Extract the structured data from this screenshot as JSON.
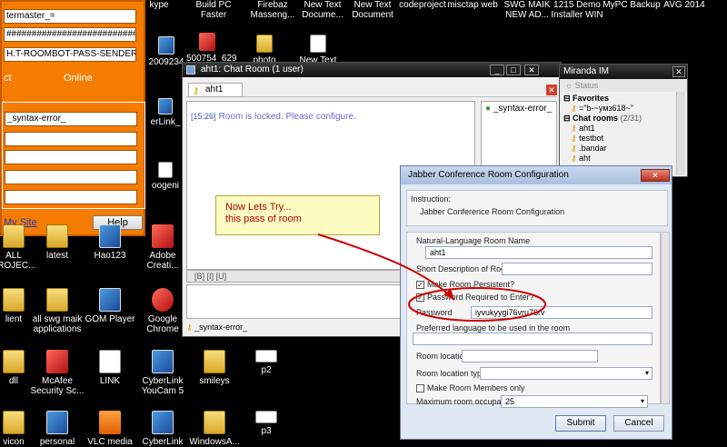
{
  "top_labels": [
    "kype",
    "Build PC Faster",
    "Firebaz Masseng...",
    "New Text Docume...",
    "New Text Document",
    "codeproject",
    "misctap web",
    "SWG MAIK NEW AD...",
    "1215 Demo Installer WIN",
    "MyPC Backup",
    "AVG 2014"
  ],
  "orange_panel": {
    "field1": "termaster_=",
    "field2": "############################",
    "field3": "H.T-ROOMBOT-PASS-SENDER",
    "status_left": "ct",
    "status_right": "Online",
    "field_syntax": "_syntax-error_",
    "my_site": "My Site",
    "help": "Help"
  },
  "left_icon_labels": [
    "2009234",
    "500754_629",
    "photo",
    "New Text",
    "erLink_",
    "oogeni"
  ],
  "desktop_icons": [
    {
      "label": "ALL PROJEC..."
    },
    {
      "label": "latest"
    },
    {
      "label": "Hao123"
    },
    {
      "label": "Adobe Creati..."
    },
    {
      "label": "lient"
    },
    {
      "label": "all swg maik applications"
    },
    {
      "label": "GOM Player"
    },
    {
      "label": "Google Chrome"
    },
    {
      "label": "dll"
    },
    {
      "label": "McAfee Security Sc..."
    },
    {
      "label": "LINK"
    },
    {
      "label": "CyberLink YouCam 5"
    },
    {
      "label": "smileys"
    },
    {
      "label": "p2"
    },
    {
      "label": "vicon"
    },
    {
      "label": "personal"
    },
    {
      "label": "VLC media"
    },
    {
      "label": "CyberLink"
    },
    {
      "label": "WindowsA..."
    },
    {
      "label": "p3"
    }
  ],
  "chat_window": {
    "title": "aht1: Chat Room (1 user)",
    "tab": "aht1",
    "timestamp": "[15:26]",
    "message": "Room is locked. Please configure.",
    "user": "_syntax-error_",
    "footer_user": "_syntax-error_"
  },
  "miranda": {
    "title": "Miranda IM",
    "status": "Status",
    "favorites": "Favorites",
    "fav_item": "=\"b-~yмз618~\"",
    "chat_rooms": "Chat rooms",
    "chat_count": "(2/31)",
    "rooms": [
      "aht1",
      "testbot",
      ".bandar",
      "aht"
    ]
  },
  "note": {
    "line1": "Now Lets Try...",
    "line2": "this pass of room"
  },
  "dialog": {
    "title": "Jabber Conference Room Configuration",
    "instruction_label": "Instruction:",
    "instruction_text": "Jabber Conference Room Configuration",
    "natural_name_label": "Natural-Language Room Name",
    "natural_name_value": "aht1",
    "short_desc_label": "Short Description of Room",
    "persistent_label": "Make Room Persistent?",
    "password_required_label": "Password Required to Enter?",
    "password_label": "Password",
    "password_value": "iyvukyygi76vru76rv",
    "lang_label": "Preferred language to be used in the room",
    "location_label": "Room location",
    "location_type_label": "Room location type",
    "members_only_label": "Make Room Members only",
    "max_occupants_label": "Maximum room occupants",
    "max_occupants_value": "25",
    "submit": "Submit",
    "cancel": "Cancel"
  },
  "colors": {
    "orange": "#f57c00",
    "highlight_red": "#d00000",
    "chat_text": "#6a6ad0"
  }
}
